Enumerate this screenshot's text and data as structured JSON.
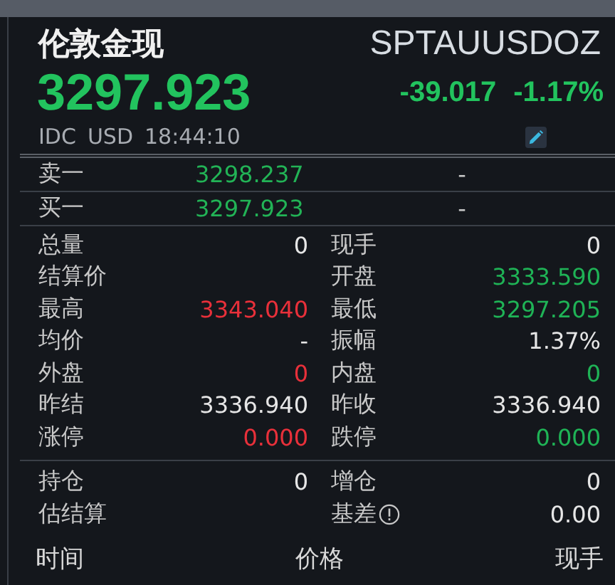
{
  "title": "伦敦金现",
  "symbol": "SPTAUUSDOZ",
  "price": "3297.923",
  "change": "-39.017",
  "change_pct": "-1.17%",
  "source": "IDC",
  "currency": "USD",
  "time": "18:44:10",
  "quotes": [
    {
      "label": "卖一",
      "price": "3298.237",
      "volume": "-"
    },
    {
      "label": "买一",
      "price": "3297.923",
      "volume": "-"
    }
  ],
  "stats": [
    {
      "label": "总量",
      "value": "0",
      "color": "#e6e6e6"
    },
    {
      "label": "现手",
      "value": "0",
      "color": "#e6e6e6"
    },
    {
      "label": "结算价"
    },
    {
      "label": "开盘",
      "value": "3333.590",
      "color": "#1fb356"
    },
    {
      "label": "最高",
      "value": "3343.040",
      "color": "#e8303a"
    },
    {
      "label": "最低",
      "value": "3297.205",
      "color": "#1fb356"
    },
    {
      "label": "均价",
      "value": "-",
      "color": "#e6e6e6"
    },
    {
      "label": "振幅",
      "value": "1.37%",
      "color": "#e6e6e6"
    },
    {
      "label": "外盘",
      "value": "0",
      "color": "#e8303a"
    },
    {
      "label": "内盘",
      "value": "0",
      "color": "#1fb356"
    },
    {
      "label": "昨结",
      "value": "3336.940",
      "color": "#e6e6e6"
    },
    {
      "label": "昨收",
      "value": "3336.940",
      "color": "#e6e6e6"
    },
    {
      "label": "涨停",
      "value": "0.000",
      "color": "#e8303a"
    },
    {
      "label": "跌停",
      "value": "0.000",
      "color": "#1fb356"
    }
  ],
  "positions": [
    {
      "label": "持仓",
      "value": "0",
      "color": "#e6e6e6"
    },
    {
      "label": "增仓",
      "value": "0",
      "color": "#e6e6e6"
    },
    {
      "label": "估结算"
    },
    {
      "label": "基差",
      "info": true,
      "value": "0.00",
      "color": "#e6e6e6"
    }
  ],
  "columns": [
    "时间",
    "价格",
    "现手"
  ]
}
